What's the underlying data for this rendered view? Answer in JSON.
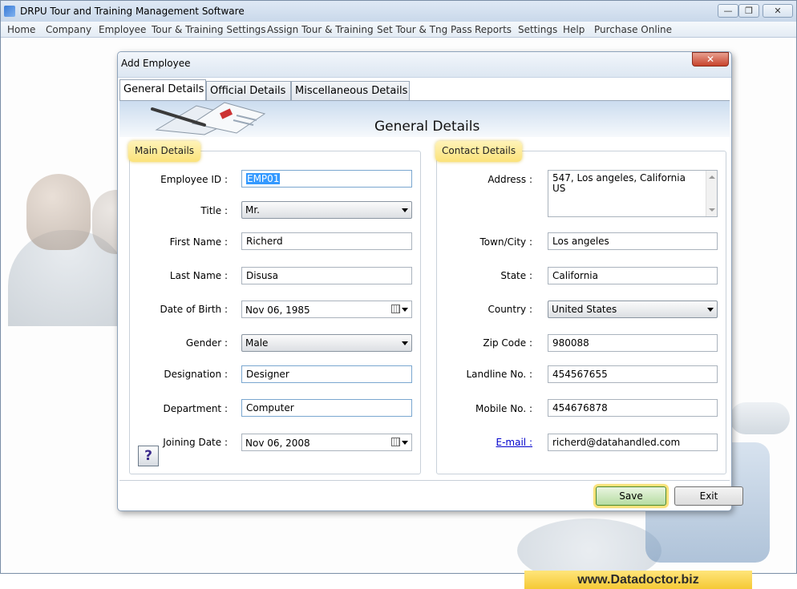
{
  "app": {
    "title": "DRPU Tour and Training Management Software",
    "controls": {
      "minimize": "—",
      "restore": "❐",
      "close": "✕"
    }
  },
  "menu": [
    "Home",
    "Company",
    "Employee",
    "Tour & Training Settings",
    "Assign Tour & Training",
    "Set Tour & Tng Pass",
    "Reports",
    "Settings",
    "Help",
    "Purchase Online"
  ],
  "dialog": {
    "title": "Add Employee",
    "close_label": "✕",
    "tabs": [
      "General Details",
      "Official Details",
      "Miscellaneous Details"
    ],
    "banner_title": "General Details",
    "main_details": {
      "legend": "Main Details",
      "employee_id": {
        "label": "Employee ID :",
        "value": "EMP01"
      },
      "title": {
        "label": "Title :",
        "value": "Mr."
      },
      "first_name": {
        "label": "First Name :",
        "value": "Richerd"
      },
      "last_name": {
        "label": "Last Name :",
        "value": "Disusa"
      },
      "date_of_birth": {
        "label": "Date of Birth :",
        "value": "Nov 06, 1985"
      },
      "gender": {
        "label": "Gender :",
        "value": "Male"
      },
      "designation": {
        "label": "Designation :",
        "value": "Designer"
      },
      "department": {
        "label": "Department :",
        "value": "Computer"
      },
      "joining_date": {
        "label": "Joining Date :",
        "value": "Nov 06, 2008"
      }
    },
    "contact_details": {
      "legend": "Contact Details",
      "address": {
        "label": "Address :",
        "line1": "547, Los angeles, California",
        "line2": "US"
      },
      "town_city": {
        "label": "Town/City :",
        "value": "Los angeles"
      },
      "state": {
        "label": "State :",
        "value": "California"
      },
      "country": {
        "label": "Country :",
        "value": "United States"
      },
      "zip_code": {
        "label": "Zip Code :",
        "value": "980088"
      },
      "landline": {
        "label": "Landline No. :",
        "value": "454567655"
      },
      "mobile": {
        "label": "Mobile No. :",
        "value": "454676878"
      },
      "email": {
        "label": "E-mail :",
        "value": "richerd@datahandled.com"
      }
    },
    "help_label": "?",
    "buttons": {
      "save": "Save",
      "exit": "Exit"
    }
  },
  "brand": "www.Datadoctor.biz"
}
